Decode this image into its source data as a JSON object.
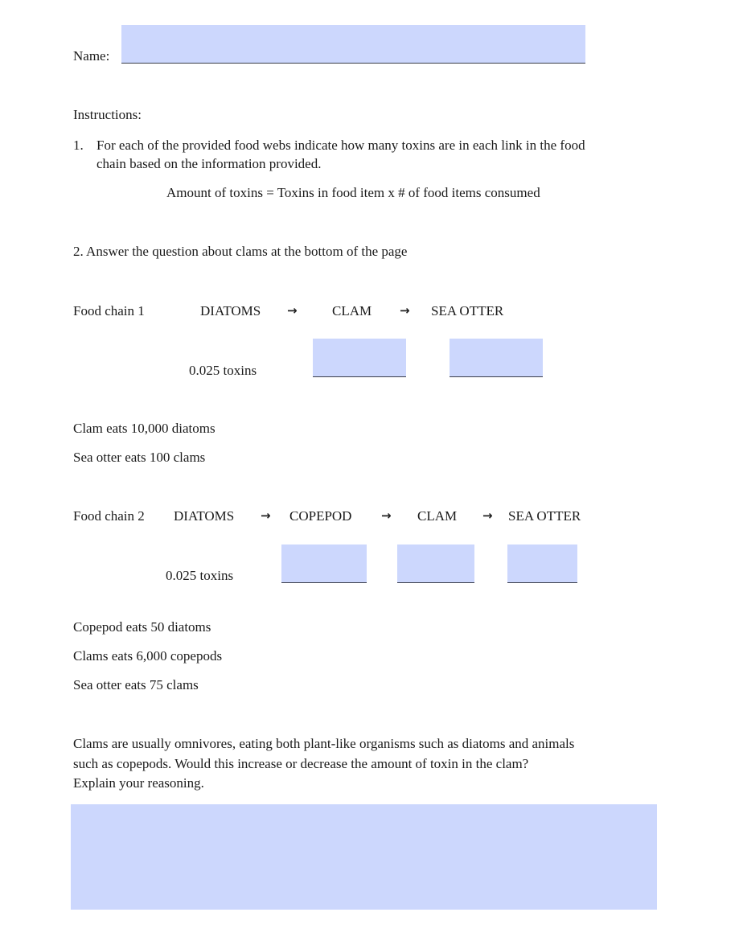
{
  "name_field": {
    "label": "Name:",
    "value": ""
  },
  "instructions": {
    "heading": "Instructions:",
    "item1_number": "1.",
    "item1_line1": "For each of the provided food webs indicate how many toxins are in each link in the food",
    "item1_line2": "chain based on the information provided.",
    "formula": "Amount of toxins = Toxins in food item  x   # of food items consumed",
    "item2": "2.  Answer the question about clams at the bottom of the page"
  },
  "food_chain_1": {
    "label": "Food chain 1",
    "organisms": [
      "DIATOMS",
      "CLAM",
      "SEA OTTER"
    ],
    "arrow": "→",
    "starting_toxins": "0.025 toxins",
    "answers": [
      "",
      ""
    ],
    "facts": [
      "Clam eats 10,000 diatoms",
      "Sea otter eats 100 clams"
    ]
  },
  "food_chain_2": {
    "label": "Food chain 2",
    "organisms": [
      "DIATOMS",
      "COPEPOD",
      "CLAM",
      "SEA OTTER"
    ],
    "arrow": "→",
    "starting_toxins": "0.025 toxins",
    "answers": [
      "",
      "",
      ""
    ],
    "facts": [
      "Copepod eats 50 diatoms",
      "Clams eats 6,000 copepods",
      "Sea otter eats 75 clams"
    ]
  },
  "question": {
    "line1": "Clams are usually omnivores, eating both plant-like organisms such as diatoms and animals",
    "line2": "such as copepods.  Would this increase or decrease the amount of toxin in the clam?",
    "line3": "Explain your reasoning.",
    "answer": ""
  },
  "colors": {
    "field_fill": "#ccd7fd",
    "text": "#1a1a1a"
  }
}
